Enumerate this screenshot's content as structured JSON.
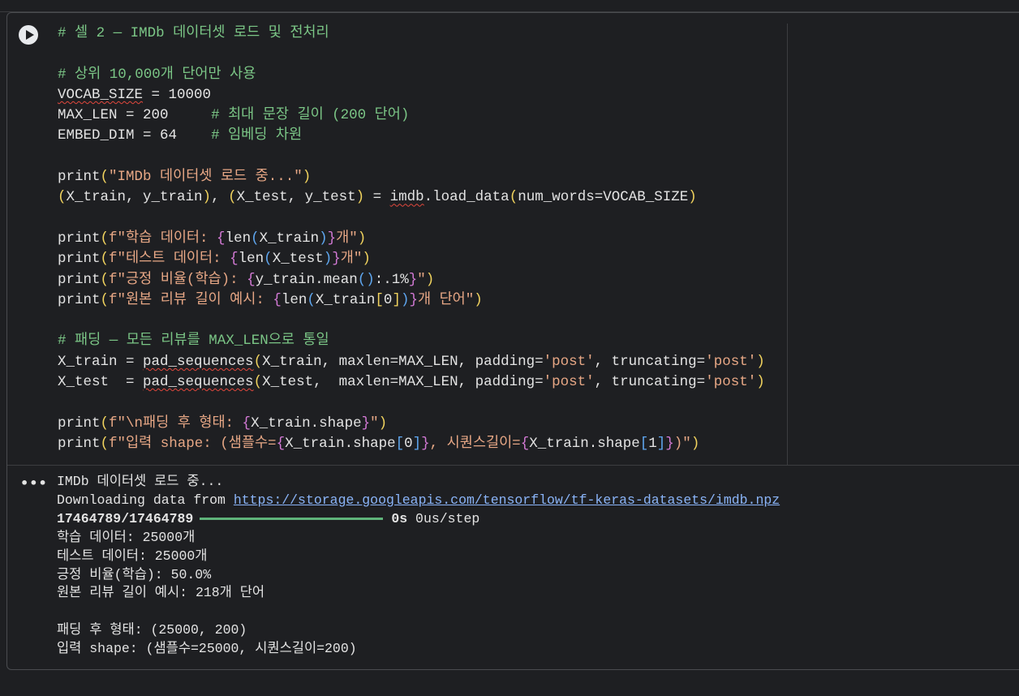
{
  "cell": {
    "code_lines": [
      "# 셀 2 — IMDb 데이터셋 로드 및 전처리",
      "",
      "# 상위 10,000개 단어만 사용",
      "VOCAB_SIZE = 10000",
      "MAX_LEN = 200     # 최대 문장 길이 (200 단어)",
      "EMBED_DIM = 64    # 임베딩 차원",
      "",
      "print(\"IMDb 데이터셋 로드 중...\")",
      "(X_train, y_train), (X_test, y_test) = imdb.load_data(num_words=VOCAB_SIZE)",
      "",
      "print(f\"학습 데이터: {len(X_train)}개\")",
      "print(f\"테스트 데이터: {len(X_test)}개\")",
      "print(f\"긍정 비율(학습): {y_train.mean():.1%}\")",
      "print(f\"원본 리뷰 길이 예시: {len(X_train[0])}개 단어\")",
      "",
      "# 패딩 — 모든 리뷰를 MAX_LEN으로 통일",
      "X_train = pad_sequences(X_train, maxlen=MAX_LEN, padding='post', truncating='post')",
      "X_test  = pad_sequences(X_test,  maxlen=MAX_LEN, padding='post', truncating='post')",
      "",
      "print(f\"\\n패딩 후 형태: {X_train.shape}\")",
      "print(f\"입력 shape: (샘플수={X_train.shape[0]}, 시퀀스길이={X_train.shape[1]})\")"
    ]
  },
  "output": {
    "line1": "IMDb 데이터셋 로드 중...",
    "download_prefix": "Downloading data from ",
    "download_url": "https://storage.googleapis.com/tensorflow/tf-keras-datasets/imdb.npz",
    "progress_counter": "17464789/17464789",
    "progress_fraction": 1.0,
    "progress_time": "0s",
    "progress_rate": "0us/step",
    "lines_after": [
      "학습 데이터: 25000개",
      "테스트 데이터: 25000개",
      "긍정 비율(학습): 50.0%",
      "원본 리뷰 길이 예시: 218개 단어",
      "",
      "패딩 후 형태: (25000, 200)",
      "입력 shape: (샘플수=25000, 시퀀스길이=200)"
    ]
  },
  "icons": {
    "run": "play-icon",
    "output_menu": "more-horizontal-icon"
  },
  "colors": {
    "background": "#1e1f22",
    "comment": "#7bc686",
    "string": "#e7a785",
    "link": "#8ab4f8",
    "progress": "#5fb37a"
  }
}
